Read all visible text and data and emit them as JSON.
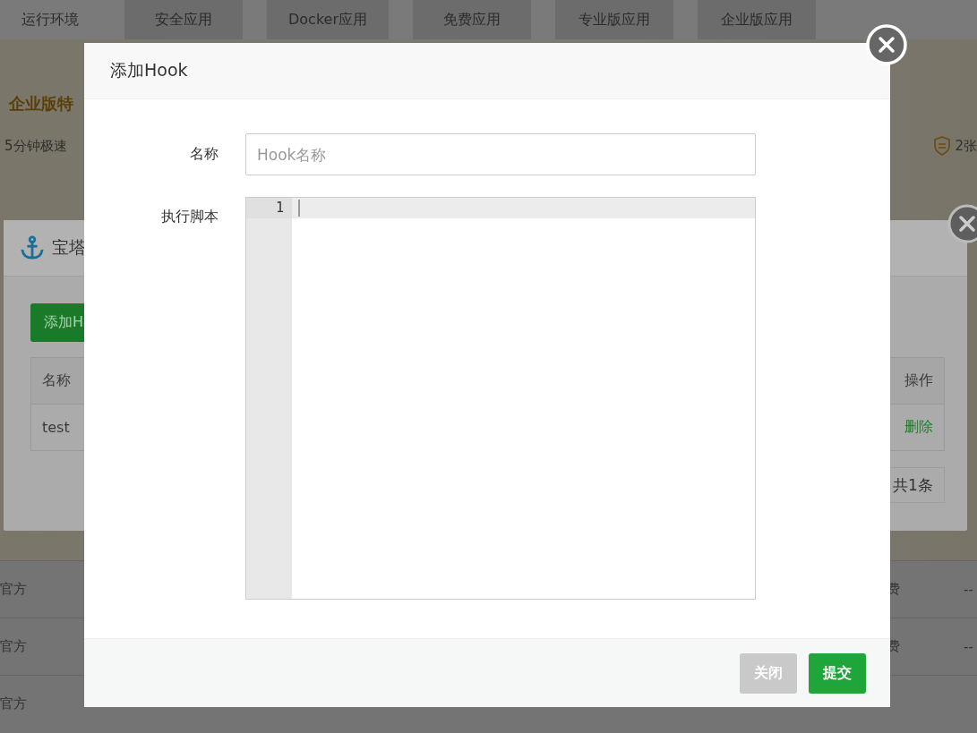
{
  "background_page": {
    "tabs": [
      {
        "label": "运行环境",
        "selected": true
      },
      {
        "label": "安全应用",
        "selected": false
      },
      {
        "label": "Docker应用",
        "selected": false
      },
      {
        "label": "免费应用",
        "selected": false
      },
      {
        "label": "专业版应用",
        "selected": false
      },
      {
        "label": "企业版应用",
        "selected": false
      }
    ],
    "banner": {
      "title": "企业版特",
      "subtitle": "5分钟极速",
      "ssl_count": "2张"
    },
    "rows": [
      {
        "source": "官方",
        "price": "费",
        "column_5": "--"
      },
      {
        "source": "官方",
        "price": "费",
        "column_5": "--"
      },
      {
        "source": "官方"
      }
    ]
  },
  "hook_list_dialog": {
    "title": "宝塔",
    "add_button": "添加H",
    "columns": [
      "名称",
      "操作"
    ],
    "rows": [
      {
        "name": "test",
        "action": "删除"
      }
    ],
    "pager": "共1条"
  },
  "add_hook_dialog": {
    "title": "添加Hook",
    "fields": [
      {
        "kind": "input",
        "label": "名称",
        "placeholder": "Hook名称"
      },
      {
        "kind": "code",
        "label": "执行脚本",
        "line_numbers": [
          "1"
        ]
      }
    ],
    "buttons": [
      {
        "label": "关闭",
        "kind": "secondary"
      },
      {
        "label": "提交",
        "kind": "primary"
      }
    ]
  }
}
